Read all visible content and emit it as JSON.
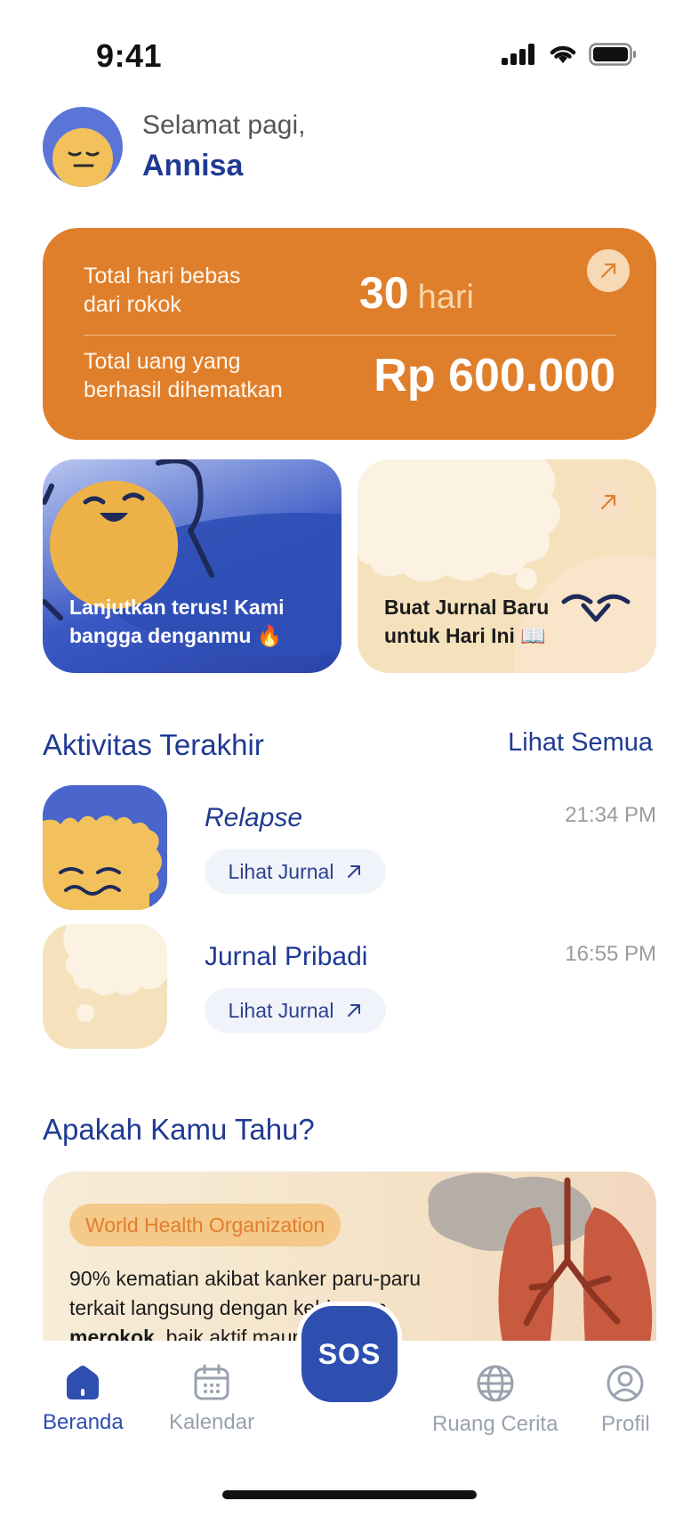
{
  "status_bar": {
    "time": "9:41"
  },
  "header": {
    "greeting": "Selamat pagi,",
    "name": "Annisa"
  },
  "stats": {
    "days_label_1": "Total hari bebas",
    "days_label_2": "dari rokok",
    "days_value": "30",
    "days_unit": "hari",
    "money_label_1": "Total uang yang",
    "money_label_2": "berhasil dihematkan",
    "money_value": "Rp 600.000"
  },
  "tiles": {
    "motivation_line_1": "Lanjutkan terus! Kami",
    "motivation_line_2": "bangga denganmu 🔥",
    "journal_line_1": "Buat Jurnal Baru",
    "journal_line_2": "untuk Hari Ini 📖"
  },
  "activity": {
    "title": "Aktivitas Terakhir",
    "see_all": "Lihat Semua",
    "items": [
      {
        "title": "Relapse",
        "time": "21:34 PM",
        "button": "Lihat Jurnal"
      },
      {
        "title": "Jurnal Pribadi",
        "time": "16:55 PM",
        "button": "Lihat Jurnal"
      }
    ]
  },
  "fact": {
    "title": "Apakah Kamu Tahu?",
    "source": "World Health Organization",
    "line_1": " 90% kematian akibat kanker paru-paru",
    "line_2": "terkait langsung dengan kebiasaan",
    "bold": "merokok",
    "line_3_rest": ", baik aktif maupun pasif."
  },
  "tabbar": {
    "items": [
      {
        "label": "Beranda",
        "icon": "home-icon"
      },
      {
        "label": "Kalendar",
        "icon": "calendar-icon"
      },
      {
        "label": "Ruang Cerita",
        "icon": "globe-icon"
      },
      {
        "label": "Profil",
        "icon": "user-icon"
      }
    ],
    "sos_label": "SOS"
  },
  "colors": {
    "primary": "#2E4FB0",
    "orange": "#E07F2B",
    "cream": "#F5E2BD",
    "yellow_face": "#F2C15C"
  }
}
